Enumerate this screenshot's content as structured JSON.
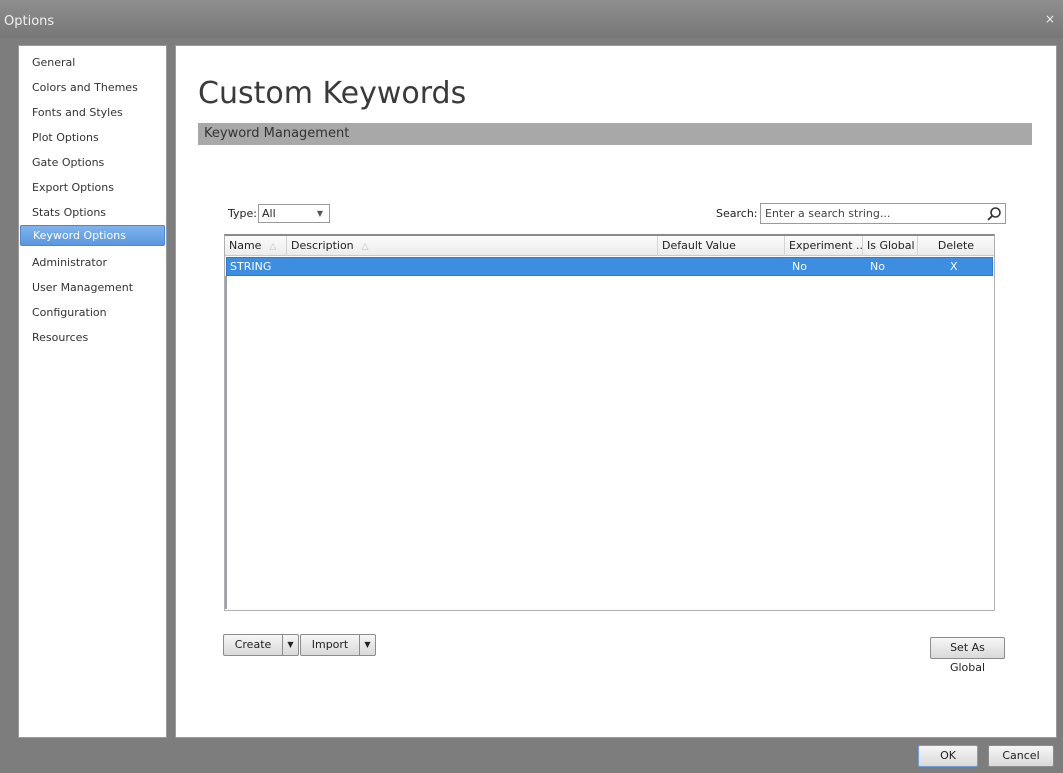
{
  "window": {
    "title": "Options",
    "close_glyph": "×"
  },
  "sidebar": {
    "items": [
      {
        "label": "General"
      },
      {
        "label": "Colors and Themes"
      },
      {
        "label": "Fonts and Styles"
      },
      {
        "label": "Plot Options"
      },
      {
        "label": "Gate Options"
      },
      {
        "label": "Export Options"
      },
      {
        "label": "Stats Options"
      },
      {
        "label": "Keyword Options",
        "selected": true
      },
      {
        "label": "Administrator"
      },
      {
        "label": "User Management"
      },
      {
        "label": "Configuration"
      },
      {
        "label": "Resources"
      }
    ]
  },
  "main": {
    "title": "Custom Keywords",
    "section": "Keyword Management",
    "type_label": "Type:",
    "type_value": "All",
    "search_label": "Search:",
    "search_placeholder": "Enter a search string...",
    "columns": [
      "Name",
      "Description",
      "Default Value",
      "Experiment ...",
      "Is Global",
      "Delete"
    ],
    "rows": [
      {
        "name": "STRING",
        "description": "",
        "default_value": "",
        "experiment": "No",
        "is_global": "No",
        "delete": "X"
      }
    ],
    "create_label": "Create",
    "import_label": "Import",
    "set_global_label": "Set As Global"
  },
  "dialog": {
    "ok_label": "OK",
    "cancel_label": "Cancel"
  },
  "colors": {
    "selection": "#3d8ee0",
    "sidebar_selection": "#5a98e0",
    "section_bar": "#a8a8a8",
    "frame": "#7d7d7d"
  }
}
